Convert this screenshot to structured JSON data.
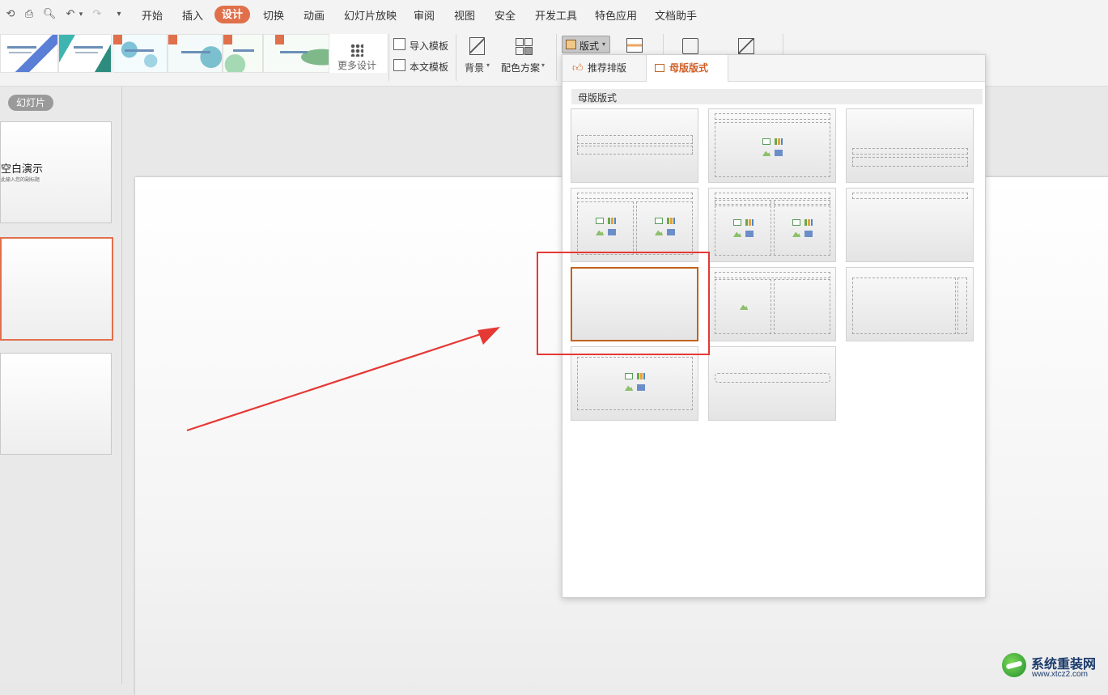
{
  "menubar": {
    "tabs": [
      "开始",
      "插入",
      "设计",
      "切换",
      "动画",
      "幻灯片放映",
      "审阅",
      "视图",
      "安全",
      "开发工具",
      "特色应用",
      "文档助手"
    ],
    "active_tab": "设计"
  },
  "ribbon": {
    "more_design": "更多设计",
    "import_template": "导入模板",
    "this_template": "本文模板",
    "background": "背景",
    "color_scheme": "配色方案",
    "layout_button": "版式"
  },
  "slides_panel": {
    "tab_label": "幻灯片",
    "slide1_title": "空白演示",
    "slide1_subtitle": "此输入您的副标题"
  },
  "layout_dropdown": {
    "tab_recommended": "推荐排版",
    "tab_master": "母版版式",
    "active_tab": "母版版式",
    "section_header": "母版版式"
  },
  "watermark": {
    "site_name": "系统重装网",
    "site_url": "www.xtcz2.com"
  },
  "colors": {
    "accent": "#e0704b",
    "highlight_red": "#e53935",
    "selected_border": "#c0631e"
  }
}
